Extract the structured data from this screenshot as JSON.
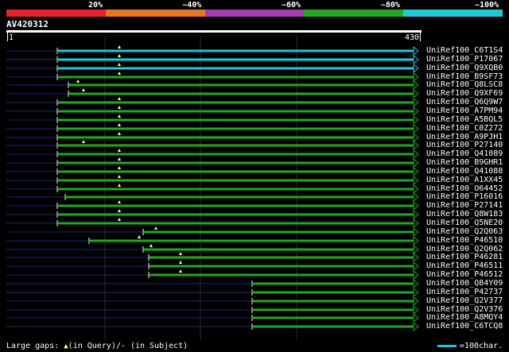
{
  "legend": {
    "colors": [
      "#e8232a",
      "#e87722",
      "#a63cb0",
      "#22a822",
      "#22c8d8"
    ],
    "labels": [
      "20%",
      "~40%",
      "~60%",
      "~80%",
      "~100%"
    ]
  },
  "query": {
    "title": "AV420312",
    "start": "1",
    "end": "430"
  },
  "hits": [
    {
      "name": "UniRef100_C6T1S4",
      "color": "#22c8d8",
      "start": 72,
      "gaps": [
        150
      ]
    },
    {
      "name": "UniRef100_P17067",
      "color": "#22c8d8",
      "start": 72,
      "gaps": [
        150
      ]
    },
    {
      "name": "UniRef100_Q9XQB0",
      "color": "#22c8d8",
      "start": 72,
      "gaps": [
        150
      ]
    },
    {
      "name": "UniRef100_B9SF73",
      "color": "#22a822",
      "start": 72,
      "gaps": [
        150
      ]
    },
    {
      "name": "UniRef100_Q8LSC8",
      "color": "#22a822",
      "start": 86,
      "gaps": [
        98
      ]
    },
    {
      "name": "UniRef100_Q9XF69",
      "color": "#22a822",
      "start": 86,
      "gaps": [
        105
      ]
    },
    {
      "name": "UniRef100_Q6Q9W7",
      "color": "#22a822",
      "start": 72,
      "gaps": [
        150
      ]
    },
    {
      "name": "UniRef100_A7PM94",
      "color": "#22a822",
      "start": 72,
      "gaps": [
        150
      ]
    },
    {
      "name": "UniRef100_A5BQL5",
      "color": "#22a822",
      "start": 72,
      "gaps": [
        150
      ]
    },
    {
      "name": "UniRef100_C0Z272",
      "color": "#22a822",
      "start": 72,
      "gaps": [
        150
      ]
    },
    {
      "name": "UniRef100_A9PJH1",
      "color": "#22a822",
      "start": 72,
      "gaps": [
        150
      ]
    },
    {
      "name": "UniRef100_P27140",
      "color": "#22a822",
      "start": 72,
      "gaps": [
        105
      ]
    },
    {
      "name": "UniRef100_Q41089",
      "color": "#22a822",
      "start": 72,
      "gaps": [
        150
      ]
    },
    {
      "name": "UniRef100_B9GHR1",
      "color": "#22a822",
      "start": 72,
      "gaps": [
        150
      ]
    },
    {
      "name": "UniRef100_Q41088",
      "color": "#22a822",
      "start": 72,
      "gaps": [
        150
      ]
    },
    {
      "name": "UniRef100_A1XX45",
      "color": "#22a822",
      "start": 72,
      "gaps": [
        150
      ]
    },
    {
      "name": "UniRef100_O64452",
      "color": "#22a822",
      "start": 72,
      "gaps": [
        150
      ]
    },
    {
      "name": "UniRef100_P16016",
      "color": "#22a822",
      "start": 82,
      "gaps": []
    },
    {
      "name": "UniRef100_P27141",
      "color": "#22a822",
      "start": 72,
      "gaps": [
        150
      ]
    },
    {
      "name": "UniRef100_Q8W183",
      "color": "#22a822",
      "start": 72,
      "gaps": [
        150
      ]
    },
    {
      "name": "UniRef100_Q5NE20",
      "color": "#22a822",
      "start": 72,
      "gaps": [
        150
      ]
    },
    {
      "name": "UniRef100_Q2Q063",
      "color": "#22a822",
      "start": 180,
      "gaps": [
        196
      ]
    },
    {
      "name": "UniRef100_P46510",
      "color": "#22a822",
      "start": 112,
      "gaps": [
        175
      ]
    },
    {
      "name": "UniRef100_Q2Q062",
      "color": "#22a822",
      "start": 180,
      "gaps": [
        190
      ]
    },
    {
      "name": "UniRef100_P46281",
      "color": "#22a822",
      "start": 187,
      "gaps": [
        227
      ]
    },
    {
      "name": "UniRef100_P46511",
      "color": "#22a822",
      "start": 187,
      "gaps": [
        227
      ]
    },
    {
      "name": "UniRef100_P46512",
      "color": "#22a822",
      "start": 187,
      "gaps": [
        227
      ]
    },
    {
      "name": "UniRef100_Q84Y09",
      "color": "#22a822",
      "start": 317,
      "gaps": []
    },
    {
      "name": "UniRef100_P42737",
      "color": "#22a822",
      "start": 317,
      "gaps": []
    },
    {
      "name": "UniRef100_Q2V377",
      "color": "#22a822",
      "start": 317,
      "gaps": []
    },
    {
      "name": "UniRef100_Q2V376",
      "color": "#22a822",
      "start": 317,
      "gaps": []
    },
    {
      "name": "UniRef100_A8MQY4",
      "color": "#22a822",
      "start": 317,
      "gaps": []
    },
    {
      "name": "UniRef100_C6TCQ8",
      "color": "#22a822",
      "start": 317,
      "gaps": []
    }
  ],
  "footer": {
    "gaps_prefix": "Large gaps: ",
    "gaps_tri": "▲",
    "gaps_suffix": "(in Query)/- (in Subject)",
    "scale_label": "=100char."
  }
}
